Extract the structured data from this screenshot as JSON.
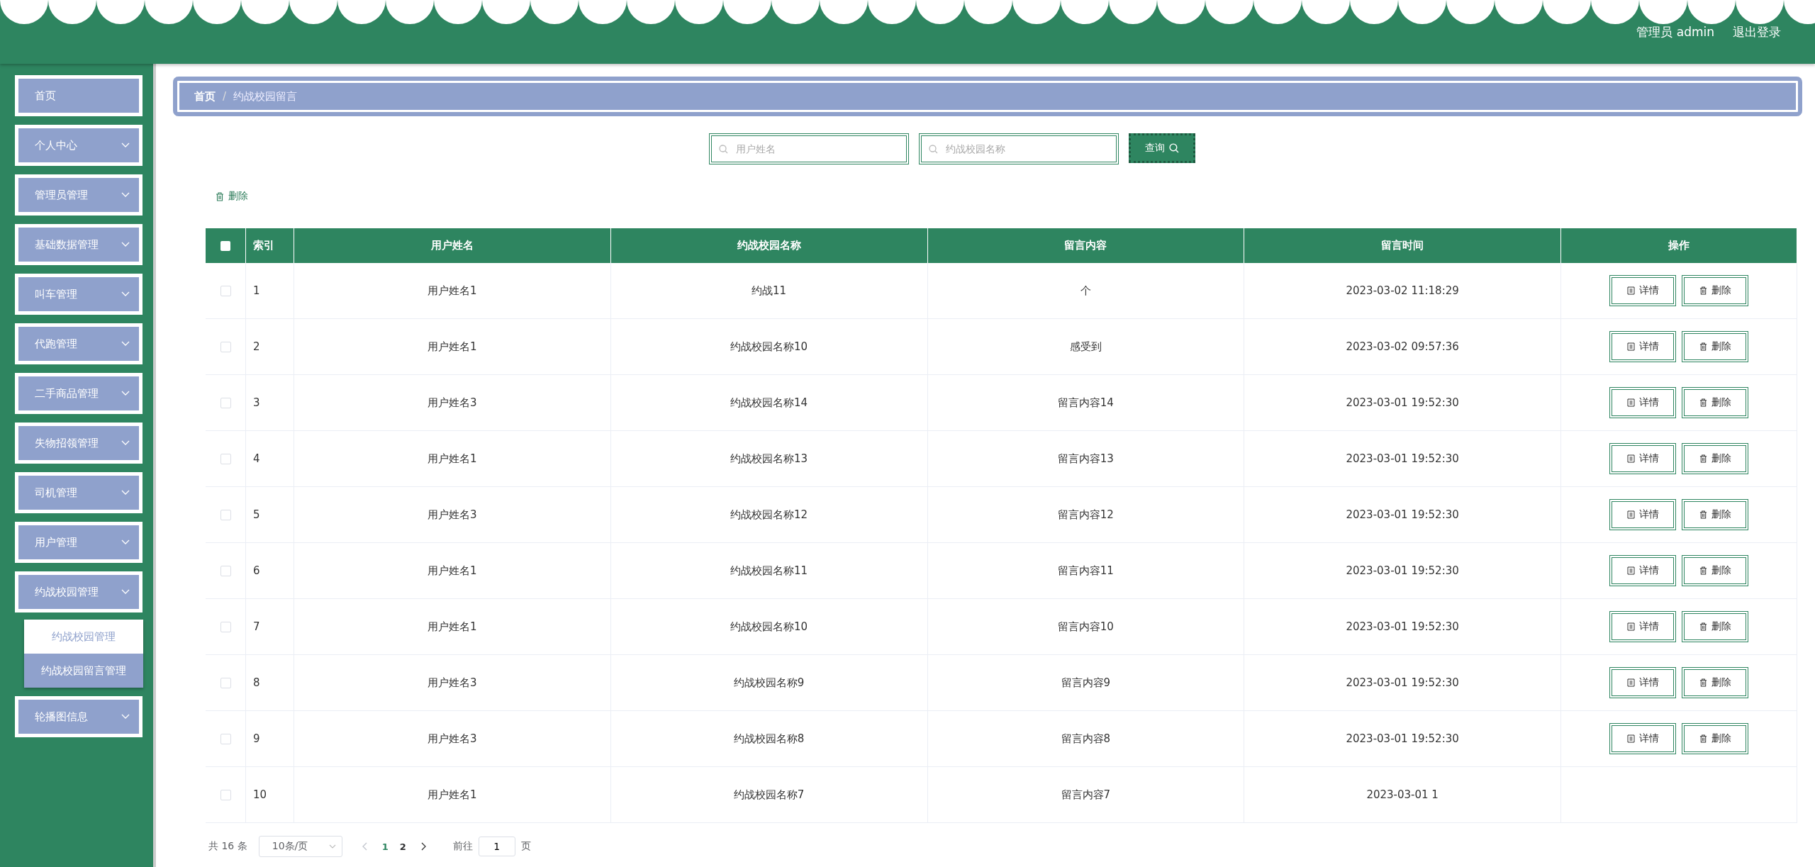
{
  "header": {
    "user": "管理员 admin",
    "logout": "退出登录"
  },
  "sidebar": {
    "items": [
      {
        "label": "首页",
        "kind": "link"
      },
      {
        "label": "个人中心",
        "kind": "group"
      },
      {
        "label": "管理员管理",
        "kind": "group"
      },
      {
        "label": "基础数据管理",
        "kind": "group"
      },
      {
        "label": "叫车管理",
        "kind": "group"
      },
      {
        "label": "代跑管理",
        "kind": "group"
      },
      {
        "label": "二手商品管理",
        "kind": "group"
      },
      {
        "label": "失物招领管理",
        "kind": "group"
      },
      {
        "label": "司机管理",
        "kind": "group"
      },
      {
        "label": "用户管理",
        "kind": "group"
      },
      {
        "label": "约战校园管理",
        "kind": "group",
        "children": [
          {
            "label": "约战校园管理",
            "selected": false
          },
          {
            "label": "约战校园留言管理",
            "selected": true
          }
        ]
      },
      {
        "label": "轮播图信息",
        "kind": "group"
      }
    ]
  },
  "breadcrumb": [
    "首页",
    "/",
    "约战校园留言"
  ],
  "search": {
    "fields": [
      {
        "placeholder": "用户姓名"
      },
      {
        "placeholder": "约战校园名称"
      }
    ],
    "button": "查询"
  },
  "toolbar": {
    "delete": "删除"
  },
  "table": {
    "columns": [
      "索引",
      "用户姓名",
      "约战校园名称",
      "留言内容",
      "留言时间",
      "操作"
    ],
    "header_checked": false,
    "rows": [
      {
        "checked": false,
        "cells": [
          "1",
          "用户姓名1",
          "约战11",
          "个",
          "2023-03-02 11:18:29"
        ],
        "actions": [
          "详情",
          "删除"
        ]
      },
      {
        "checked": false,
        "cells": [
          "2",
          "用户姓名1",
          "约战校园名称10",
          "感受到",
          "2023-03-02 09:57:36"
        ],
        "actions": [
          "详情",
          "删除"
        ]
      },
      {
        "checked": false,
        "cells": [
          "3",
          "用户姓名3",
          "约战校园名称14",
          "留言内容14",
          "2023-03-01 19:52:30"
        ],
        "actions": [
          "详情",
          "删除"
        ]
      },
      {
        "checked": false,
        "cells": [
          "4",
          "用户姓名1",
          "约战校园名称13",
          "留言内容13",
          "2023-03-01 19:52:30"
        ],
        "actions": [
          "详情",
          "删除"
        ]
      },
      {
        "checked": false,
        "cells": [
          "5",
          "用户姓名3",
          "约战校园名称12",
          "留言内容12",
          "2023-03-01 19:52:30"
        ],
        "actions": [
          "详情",
          "删除"
        ]
      },
      {
        "checked": false,
        "cells": [
          "6",
          "用户姓名1",
          "约战校园名称11",
          "留言内容11",
          "2023-03-01 19:52:30"
        ],
        "actions": [
          "详情",
          "删除"
        ]
      },
      {
        "checked": false,
        "cells": [
          "7",
          "用户姓名1",
          "约战校园名称10",
          "留言内容10",
          "2023-03-01 19:52:30"
        ],
        "actions": [
          "详情",
          "删除"
        ]
      },
      {
        "checked": false,
        "cells": [
          "8",
          "用户姓名3",
          "约战校园名称9",
          "留言内容9",
          "2023-03-01 19:52:30"
        ],
        "actions": [
          "详情",
          "删除"
        ]
      },
      {
        "checked": false,
        "cells": [
          "9",
          "用户姓名3",
          "约战校园名称8",
          "留言内容8",
          "2023-03-01 19:52:30"
        ],
        "actions": [
          "详情",
          "删除"
        ]
      },
      {
        "checked": false,
        "cells": [
          "10",
          "用户姓名1",
          "约战校园名称7",
          "留言内容7",
          "2023-03-01 1"
        ]
      }
    ]
  },
  "pagination": {
    "total": "共 16 条",
    "page_size": "10条/页",
    "pages": [
      {
        "label": "1",
        "selected": true
      },
      {
        "label": "2",
        "selected": false
      }
    ],
    "goto": "前往",
    "goto_value": "1",
    "goto_suffix": "页"
  }
}
